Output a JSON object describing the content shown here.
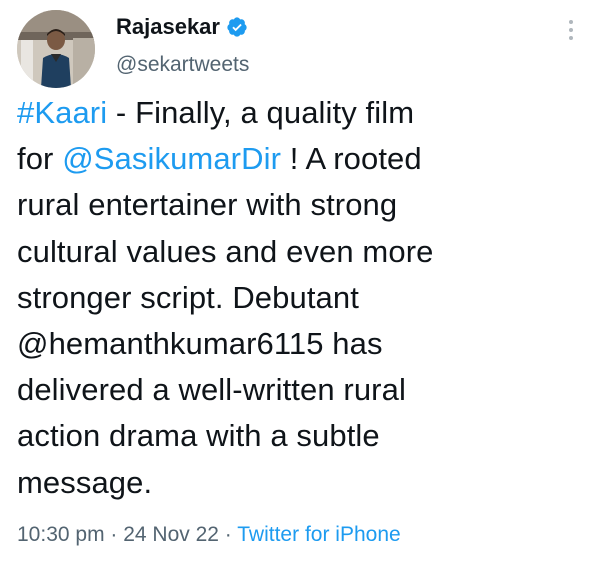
{
  "author": {
    "name": "Rajasekar",
    "handle": "@sekartweets",
    "verified": true,
    "avatar_icon": "profile-photo"
  },
  "tweet": {
    "lines": [
      {
        "parts": [
          {
            "text": "#Kaari",
            "link": true
          },
          {
            "text": " - Finally, a quality film",
            "link": false
          }
        ]
      },
      {
        "parts": [
          {
            "text": "for ",
            "link": false
          },
          {
            "text": "@SasikumarDir",
            "link": true
          },
          {
            "text": " ! A rooted",
            "link": false
          }
        ]
      },
      {
        "parts": [
          {
            "text": "rural entertainer with strong",
            "link": false
          }
        ]
      },
      {
        "parts": [
          {
            "text": "cultural values and even more",
            "link": false
          }
        ]
      },
      {
        "parts": [
          {
            "text": "stronger script. Debutant",
            "link": false
          }
        ]
      },
      {
        "parts": [
          {
            "text": "@hemanthkumar6115 has",
            "link": false
          }
        ]
      },
      {
        "parts": [
          {
            "text": "delivered a well-written rural",
            "link": false
          }
        ]
      },
      {
        "parts": [
          {
            "text": "action drama with a subtle",
            "link": false
          }
        ]
      },
      {
        "parts": [
          {
            "text": "message.",
            "link": false
          }
        ]
      }
    ]
  },
  "meta": {
    "time": "10:30 pm",
    "separator": " · ",
    "date": "24 Nov 22",
    "source": "Twitter for iPhone"
  },
  "colors": {
    "link": "#1d9bf0",
    "secondary_text": "#536471",
    "primary_text": "#0f1419"
  },
  "icons": {
    "verified": "verified-badge-icon",
    "more": "more-options-icon"
  }
}
